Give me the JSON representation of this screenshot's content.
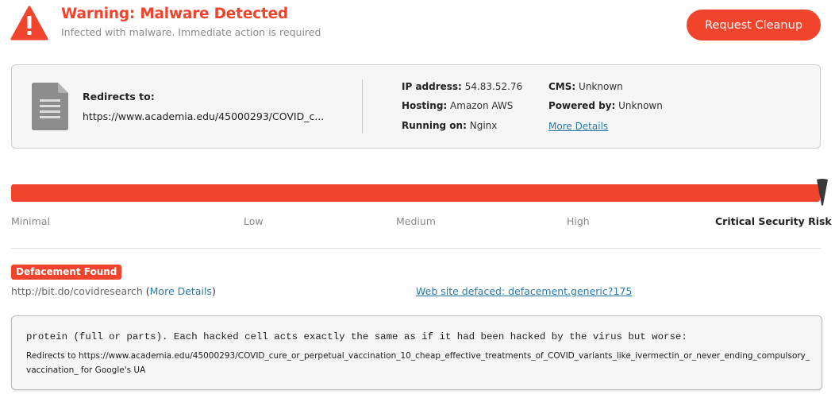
{
  "header": {
    "title": "Warning: Malware Detected",
    "subtitle": "Infected with malware. Immediate action is required",
    "cleanup_button": "Request Cleanup"
  },
  "site_info": {
    "redirects_label": "Redirects to:",
    "redirects_url": "https://www.academia.edu/45000293/COVID_c...",
    "ip_label": "IP address:",
    "ip_value": "54.83.52.76",
    "hosting_label": "Hosting:",
    "hosting_value": "Amazon AWS",
    "running_label": "Running on:",
    "running_value": "Nginx",
    "cms_label": "CMS:",
    "cms_value": "Unknown",
    "powered_label": "Powered by:",
    "powered_value": "Unknown",
    "more_details": "More Details"
  },
  "risk": {
    "level_fraction": 1.0,
    "labels": [
      "Minimal",
      "Low",
      "Medium",
      "High",
      "Critical Security Risk"
    ]
  },
  "defacement": {
    "badge": "Defacement Found",
    "url": "http://bit.do/covidresearch",
    "open_paren": " (",
    "more_details": "More Details",
    "close_paren": ")",
    "defaced_link": "Web site defaced: defacement.generic?175",
    "code_line": "protein (full or parts). Each hacked cell acts exactly the same as if it had been hacked by the virus but worse:",
    "redirect_text": "Redirects to https://www.academia.edu/45000293/COVID_cure_or_perpetual_vaccination_10_cheap_effective_treatments_of_COVID_variants_like_ivermectin_or_never_ending_compulsory_vaccination_ for Google's UA"
  },
  "colors": {
    "accent": "#f0442c",
    "link": "#2a7aa8"
  }
}
